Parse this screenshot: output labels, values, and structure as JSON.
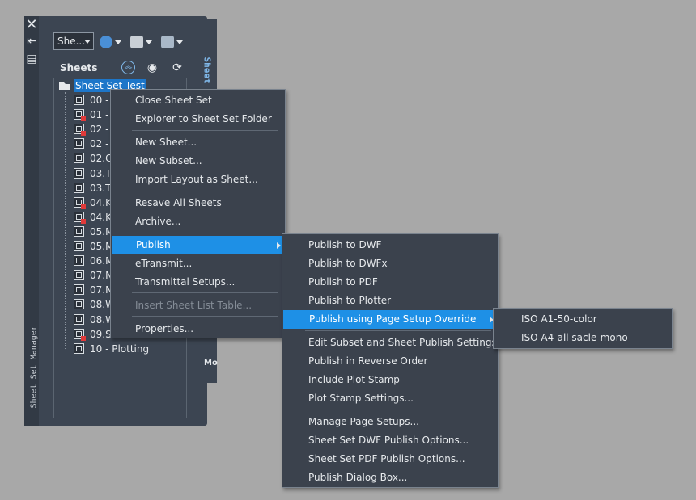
{
  "palette": {
    "title": "Sheet Set Manager",
    "tab_sheet_list": "Sheet List",
    "tab_model": "Mo",
    "toolbar": {
      "dropdown_value": "She..."
    },
    "sheets_header": "Sheets",
    "root": "Sheet Set Test",
    "tree_items": [
      "00 -",
      "01 -",
      "02 -",
      "02 -",
      "02.C",
      "03.To",
      "03.To",
      "04.K",
      "04.K",
      "05.M",
      "05.M",
      "06.M",
      "07.N",
      "07.N",
      "08.W",
      "08.W",
      "09.S",
      "10 - Plotting"
    ],
    "tree_errors": [
      false,
      true,
      true,
      false,
      false,
      false,
      false,
      true,
      true,
      false,
      false,
      false,
      false,
      false,
      false,
      false,
      true,
      false
    ]
  },
  "context_menu": {
    "items": [
      {
        "label": "Close Sheet Set"
      },
      {
        "label": "Explorer to Sheet Set Folder"
      },
      {
        "label": "New Sheet..."
      },
      {
        "label": "New Subset..."
      },
      {
        "label": "Import Layout as Sheet..."
      },
      {
        "label": "Resave All Sheets"
      },
      {
        "label": "Archive..."
      },
      {
        "label": "Publish"
      },
      {
        "label": "eTransmit..."
      },
      {
        "label": "Transmittal Setups..."
      },
      {
        "label": "Insert Sheet List Table..."
      },
      {
        "label": "Properties..."
      }
    ]
  },
  "publish_menu": {
    "items": [
      {
        "label": "Publish to DWF"
      },
      {
        "label": "Publish to DWFx"
      },
      {
        "label": "Publish to PDF"
      },
      {
        "label": "Publish to Plotter"
      },
      {
        "label": "Publish using Page Setup Override"
      },
      {
        "label": "Edit Subset and Sheet Publish Settings..."
      },
      {
        "label": "Publish in Reverse Order"
      },
      {
        "label": "Include Plot Stamp"
      },
      {
        "label": "Plot Stamp Settings..."
      },
      {
        "label": "Manage Page Setups..."
      },
      {
        "label": "Sheet Set DWF Publish Options..."
      },
      {
        "label": "Sheet Set PDF Publish Options..."
      },
      {
        "label": "Publish Dialog Box..."
      }
    ]
  },
  "override_menu": {
    "items": [
      {
        "label": "ISO A1-50-color"
      },
      {
        "label": "ISO A4-all sacle-mono"
      }
    ]
  },
  "colors": {
    "highlight": "#1e90e6",
    "selection": "#1d76c9",
    "panel": "#3c4552",
    "menu": "#3b424d"
  }
}
